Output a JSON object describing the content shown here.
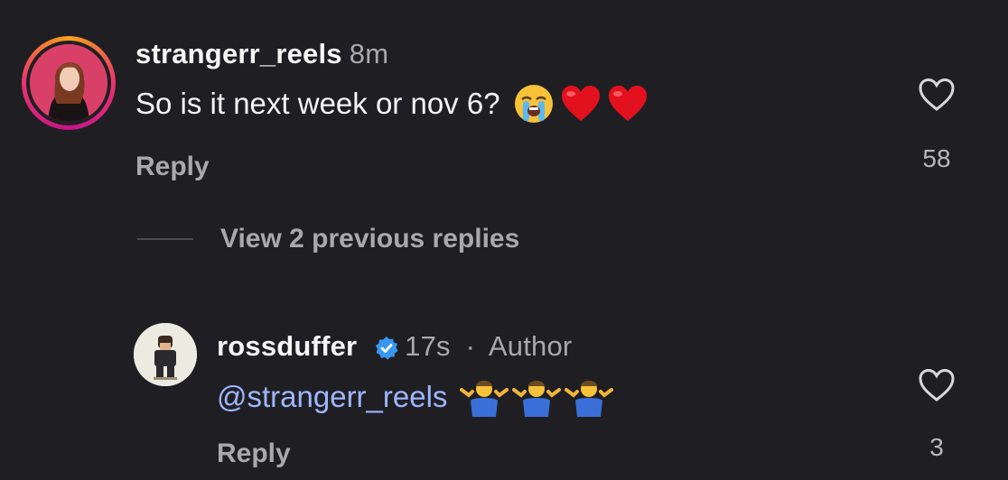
{
  "top_comment": {
    "username": "strangerr_reels",
    "time": "8m",
    "text": "So is it next week or nov 6?",
    "emojis": [
      "loudly-crying-face-emoji",
      "red-heart-emoji",
      "red-heart-emoji"
    ],
    "reply_label": "Reply",
    "like_count": "58"
  },
  "view_replies_label": "View 2 previous replies",
  "reply_comment": {
    "username": "rossduffer",
    "verified": true,
    "time": "17s",
    "separator": "·",
    "role": "Author",
    "mention": "@strangerr_reels",
    "emojis": [
      "man-shrugging-emoji",
      "man-shrugging-emoji",
      "man-shrugging-emoji"
    ],
    "reply_label": "Reply",
    "like_count": "3"
  },
  "colors": {
    "background": "#1f1f23",
    "text_primary": "#f5f5f5",
    "text_secondary": "#a9a9ad",
    "mention": "#9fb6ff",
    "verified_badge": "#3897f0",
    "story_ring_start": "#f9a21b",
    "story_ring_end": "#c5148a"
  }
}
